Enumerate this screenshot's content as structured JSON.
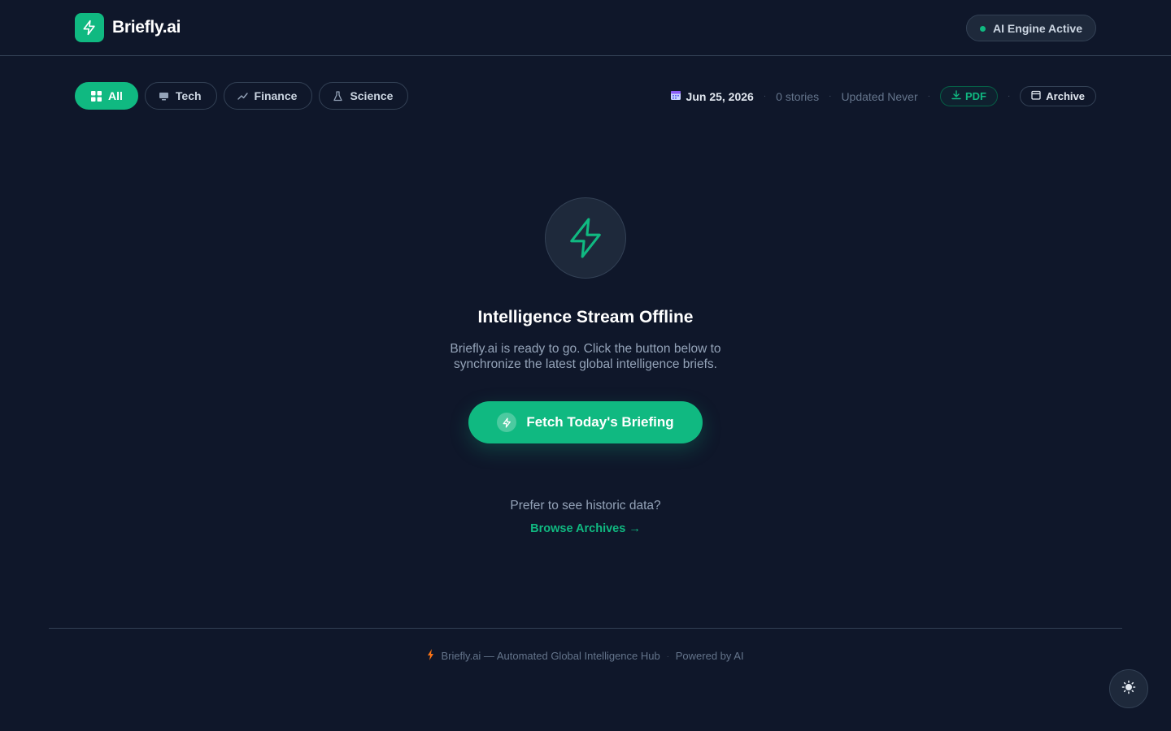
{
  "header": {
    "brand_name": "Briefly.ai",
    "engine_status": "AI Engine Active"
  },
  "filters": [
    {
      "label": "All",
      "icon": "grid-icon",
      "active": true
    },
    {
      "label": "Tech",
      "icon": "monitor-icon",
      "active": false
    },
    {
      "label": "Finance",
      "icon": "trend-icon",
      "active": false
    },
    {
      "label": "Science",
      "icon": "flask-icon",
      "active": false
    }
  ],
  "meta": {
    "date": "Jun 25, 2026",
    "stories": "0 stories",
    "updated": "Updated Never",
    "pdf_label": "PDF",
    "archive_label": "Archive"
  },
  "empty_state": {
    "title": "Intelligence Stream Offline",
    "description": "Briefly.ai is ready to go. Click the button below to synchronize the latest global intelligence briefs.",
    "fetch_label": "Fetch Today's Briefing",
    "historic_prompt": "Prefer to see historic data?",
    "browse_label": "Browse Archives →"
  },
  "footer": {
    "text": "Briefly.ai — Automated Global Intelligence Hub",
    "powered": "Powered by AI"
  },
  "colors": {
    "background": "#0f172a",
    "accent": "#10b981",
    "surface": "#1e293b",
    "border": "#334155"
  }
}
